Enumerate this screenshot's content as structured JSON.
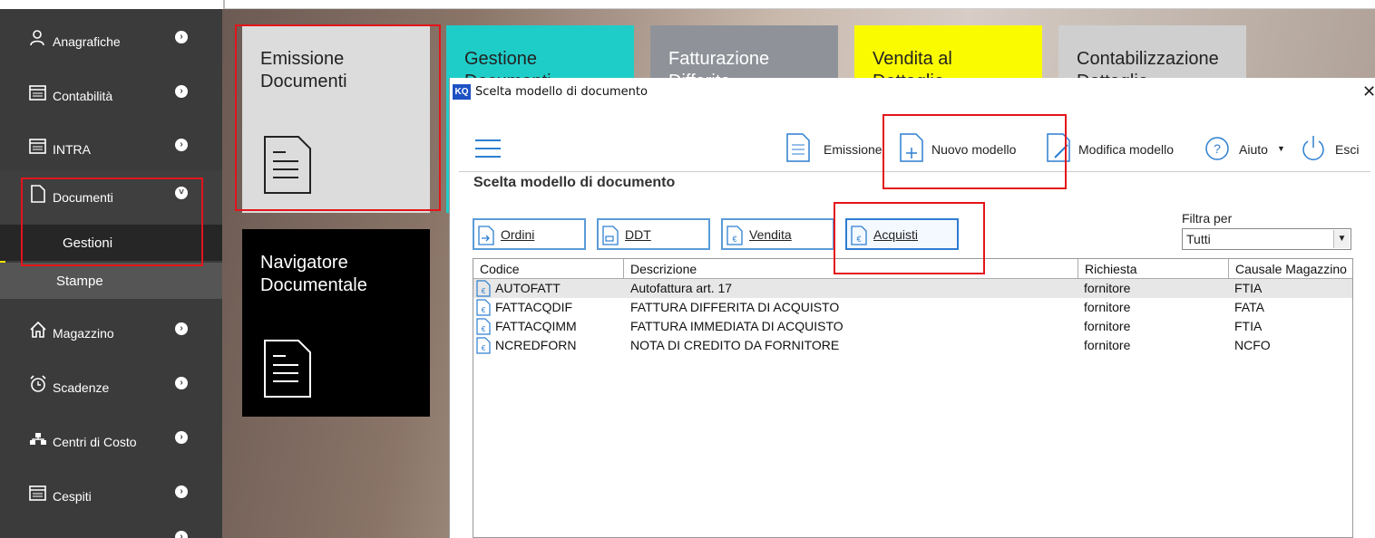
{
  "sidebar": {
    "items": [
      {
        "label": "Anagrafiche",
        "icon": "user-icon"
      },
      {
        "label": "Contabilità",
        "icon": "calendar-icon"
      },
      {
        "label": "INTRA",
        "icon": "calendar-icon"
      },
      {
        "label": "Documenti",
        "icon": "document-icon"
      },
      {
        "label": "Magazzino",
        "icon": "home-icon"
      },
      {
        "label": "Scadenze",
        "icon": "alarm-clock-icon"
      },
      {
        "label": "Centri di Costo",
        "icon": "org-chart-icon"
      },
      {
        "label": "Cespiti",
        "icon": "calendar-icon"
      }
    ],
    "sub_items": [
      "Gestioni",
      "Stampe"
    ],
    "accent": "#f5e300"
  },
  "tiles": {
    "emissione": "Emissione Documenti",
    "gestione": "Gestione Documenti",
    "fatturazione": "Fatturazione Differita",
    "vendita": "Vendita al Dettaglio",
    "contabilizzazione": "Contabilizzazione Dettaglio",
    "navigatore": "Navigatore Documentale",
    "colors": {
      "gestione": "#1fcdc8",
      "fatturazione": "#8f9399",
      "vendita": "#fbfb00",
      "contabilizzazione": "#cfcfcf",
      "emissione": "#dcdcdc",
      "navigatore": "#000000"
    }
  },
  "dialog": {
    "title": "Scelta modello di documento",
    "toolbar": {
      "emissione": "Emissione",
      "nuovo_modello": "Nuovo modello",
      "modifica_modello": "Modifica modello",
      "aiuto": "Aiuto",
      "esci": "Esci"
    },
    "section_title": "Scelta modello di documento",
    "doc_types": [
      "Ordini",
      "DDT",
      "Vendita",
      "Acquisti"
    ],
    "filter": {
      "label": "Filtra per",
      "value": "Tutti"
    },
    "grid": {
      "columns": [
        "Codice",
        "Descrizione",
        "Richiesta",
        "Causale Magazzino"
      ],
      "rows": [
        [
          "AUTOFATT",
          "Autofattura art. 17",
          "fornitore",
          "FTIA"
        ],
        [
          "FATTACQDIF",
          "FATTURA DIFFERITA DI ACQUISTO",
          "fornitore",
          "FATA"
        ],
        [
          "FATTACQIMM",
          "FATTURA IMMEDIATA DI ACQUISTO",
          "fornitore",
          "FTIA"
        ],
        [
          "NCREDFORN",
          "NOTA DI CREDITO DA FORNITORE",
          "fornitore",
          "NCFO"
        ]
      ]
    }
  }
}
